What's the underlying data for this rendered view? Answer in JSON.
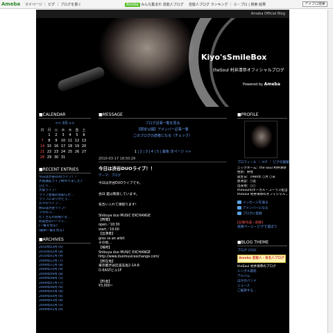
{
  "topbar": {
    "logo": "Ameba",
    "nav": "マイページ ｜ ピグ ｜ ブログを書く",
    "ad_tag": "Ameba",
    "ad_text": "みんな集まれ 芸能人ブログ",
    "links": "芸能人ブログ ランキング ｜ 小・プロ | 検索 結果",
    "search_button": "アメブロ検索"
  },
  "header": {
    "official": "Ameba Official Blog",
    "title": "Kiyo'sSmileBox",
    "subtitle": "theSoul  村井清恭オフィシャルブログ",
    "powered_label": "Powered by",
    "powered_brand": "Ameba"
  },
  "calendar": {
    "heading": "■CALENDAR",
    "month": "<< 3月 >>",
    "weekdays": [
      "日",
      "月",
      "火",
      "水",
      "木",
      "金",
      "土"
    ],
    "weeks": [
      [
        "",
        "1",
        "2",
        "3",
        "4",
        "5",
        "6"
      ],
      [
        "7",
        "8",
        "9",
        "10",
        "11",
        "12",
        "13"
      ],
      [
        "14",
        "15",
        "16",
        "17",
        "18",
        "19",
        "20"
      ],
      [
        "21",
        "22",
        "23",
        "24",
        "25",
        "26",
        "27"
      ],
      [
        "28",
        "29",
        "30",
        "31",
        "",
        "",
        ""
      ]
    ]
  },
  "recent": {
    "heading": "■RECENT ENTRIES",
    "items": [
      "今日は渋谷DUOライブ！！",
      "大阪遠征ライブ終わりました♪",
      "ひとり…",
      "大阪ライブ！",
      "ライブ会場のお知らせ…",
      "ライブにありがとう…",
      "久々のライブ…",
      "明日は渋谷ライブ！",
      "うちのコ…",
      "たくさんのお祝いを…",
      "お誕生日パーティ…",
      "[一覧を見る]",
      "[最新一覧を見る]"
    ]
  },
  "archives": {
    "heading": "■ARCHIVES",
    "items": [
      "2010年03月 (6)",
      "2010年02月 (8)",
      "2010年01月 (9)",
      "2009年12月 (7)",
      "2009年11月 (8)",
      "2009年10月 (9)",
      "2009年09月 (8)",
      "2009年08月 (5)",
      "2009年07月 (7)",
      "2009年06月 (6)",
      "2009年05月 (8)",
      "2009年04月 (6)",
      "2009年03月 (8)",
      "2009年02月 (5)",
      "2009年01月 (6)"
    ]
  },
  "message": {
    "heading": "■MESSAGE",
    "lines": [
      "ブログ記事一覧を見る",
      "【限定公開】アメンバー記事一覧",
      "このブログの読者になる（チェック）"
    ]
  },
  "pager": {
    "current": "1",
    "pages": [
      "2",
      "3",
      "4",
      "5"
    ],
    "last": "最後",
    "next": "次ページ >>"
  },
  "entry": {
    "date": "2010-03-17 18:50:29",
    "title": "今日は渋谷DUOライブ！！",
    "theme": "テーマ：ブログ",
    "lines": [
      "今日は渋谷DUOライブです。",
      "",
      "会日 是は緊張しています。",
      "",
      "気合い入れて頑張ります！",
      "",
      "Shibuya duo MUSIC EXCHANGE",
      "【時間】",
      "open／18:30",
      "start／19:00",
      "【出演者】",
      "grav ss an arbit",
      "その他…",
      "【場所】",
      "Shibuya duo MUSIC EXCHANGE",
      "http://www.duomusicexchange.com/",
      "【所在地】",
      "東京都渋谷区道玄坂2-14-8",
      "O-EASTビル1F",
      "",
      "【料金】",
      "¥3,000~"
    ]
  },
  "profile": {
    "heading": "■PROFILE",
    "links": "プロフィール ｜ ＨＰ ｜ ピグの部屋",
    "text": [
      "ニックネーム：the Soul 村井清恭",
      "性別：男性",
      "誕生日：1984年 ○月 ○日",
      "血液型：○型",
      "出身地：○○",
      "theSoulのボーカル・コーラス担当。",
      "theSoul 村井清恭のオフィシャルブログ。詳細はこちら"
    ],
    "buttons": [
      "メッセージを送る",
      "アメンバーになる",
      "ブログに登録"
    ]
  },
  "promo": {
    "line1": "[記事作成・削除]",
    "line2": "会員ページ・ピグで遊ぼう"
  },
  "theme": {
    "heading": "■BLOG THEME",
    "first": "ブログ (152)",
    "logo": "Ameba 芸能人・有名人ブログ",
    "items": [
      "theSoul  村井清恭のブログ",
      "シングル発売",
      "アルバム",
      "ほかのバンド",
      "ニュース",
      "ご挨拶する…"
    ]
  }
}
